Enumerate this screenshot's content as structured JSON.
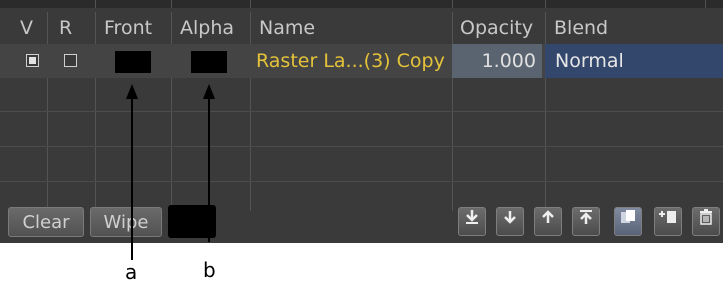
{
  "header": {
    "v": "V",
    "r": "R",
    "front": "Front",
    "alpha": "Alpha",
    "name": "Name",
    "opacity": "Opacity",
    "blend": "Blend"
  },
  "layer": {
    "visible_checked": true,
    "render_checked": false,
    "name": "Raster La...(3) Copy",
    "opacity": "1.000",
    "blend": "Normal"
  },
  "footer": {
    "clear_label": "Clear",
    "wipe_label": "Wipe",
    "icons": [
      "move-to-bottom-icon",
      "move-down-icon",
      "move-up-icon",
      "move-to-top-icon",
      "duplicate-layer-icon",
      "add-layer-icon",
      "delete-layer-icon"
    ]
  },
  "callouts": {
    "a": "a",
    "b": "b"
  }
}
